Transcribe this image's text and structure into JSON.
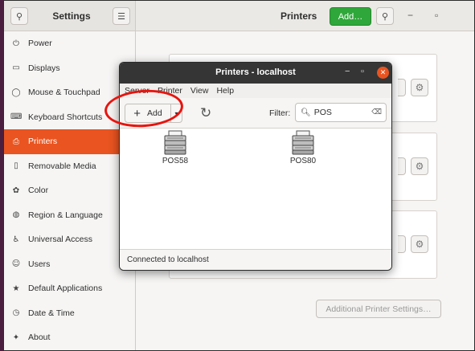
{
  "settings": {
    "title": "Settings",
    "panel_title": "Printers",
    "add_label": "Add…",
    "additional_label": "Additional Printer Settings…",
    "sidebar": [
      {
        "label": "Power",
        "icon": "power-icon",
        "glyph": "⏻"
      },
      {
        "label": "Displays",
        "icon": "display-icon",
        "glyph": "▭"
      },
      {
        "label": "Mouse & Touchpad",
        "icon": "mouse-icon",
        "glyph": "◯"
      },
      {
        "label": "Keyboard Shortcuts",
        "icon": "keyboard-icon",
        "glyph": "⌨"
      },
      {
        "label": "Printers",
        "icon": "printer-icon",
        "glyph": "⎙",
        "active": true
      },
      {
        "label": "Removable Media",
        "icon": "removable-media-icon",
        "glyph": "▯"
      },
      {
        "label": "Color",
        "icon": "color-icon",
        "glyph": "✿"
      },
      {
        "label": "Region & Language",
        "icon": "globe-icon",
        "glyph": "◍"
      },
      {
        "label": "Universal Access",
        "icon": "accessibility-icon",
        "glyph": "♿"
      },
      {
        "label": "Users",
        "icon": "users-icon",
        "glyph": "☺"
      },
      {
        "label": "Default Applications",
        "icon": "star-icon",
        "glyph": "★"
      },
      {
        "label": "Date & Time",
        "icon": "clock-icon",
        "glyph": "◷"
      },
      {
        "label": "About",
        "icon": "about-icon",
        "glyph": "✦"
      }
    ]
  },
  "dialog": {
    "title": "Printers - localhost",
    "menu": [
      "Server",
      "Printer",
      "View",
      "Help"
    ],
    "add_label": "Add",
    "filter_label": "Filter:",
    "filter_value": "POS",
    "printers": [
      "POS58",
      "POS80"
    ],
    "status": "Connected to localhost"
  },
  "colors": {
    "accent": "#e95420",
    "add_green": "#2fa73a",
    "annotation": "#e8140e"
  }
}
